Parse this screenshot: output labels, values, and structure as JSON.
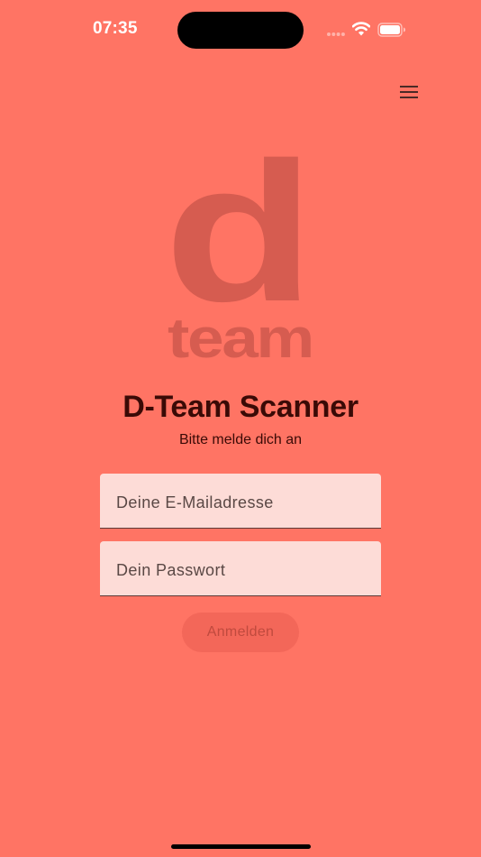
{
  "status_bar": {
    "time": "07:35",
    "icons": [
      "signal-icon",
      "wifi-icon",
      "battery-icon"
    ]
  },
  "header": {
    "menu_icon": "menu-icon"
  },
  "logo": {
    "letter": "d",
    "wordmark": "team",
    "color": "#D65C50"
  },
  "main": {
    "title": "D-Team Scanner",
    "subtitle": "Bitte melde dich an"
  },
  "form": {
    "email_placeholder": "Deine E-Mailadresse",
    "email_value": "",
    "password_placeholder": "Dein Passwort",
    "password_value": "",
    "login_label": "Anmelden",
    "login_enabled": false
  },
  "colors": {
    "background": "#FF7464",
    "field_background": "#FDDCD7",
    "title_text": "#3a0a06",
    "button_disabled_bg": "#F36759"
  }
}
